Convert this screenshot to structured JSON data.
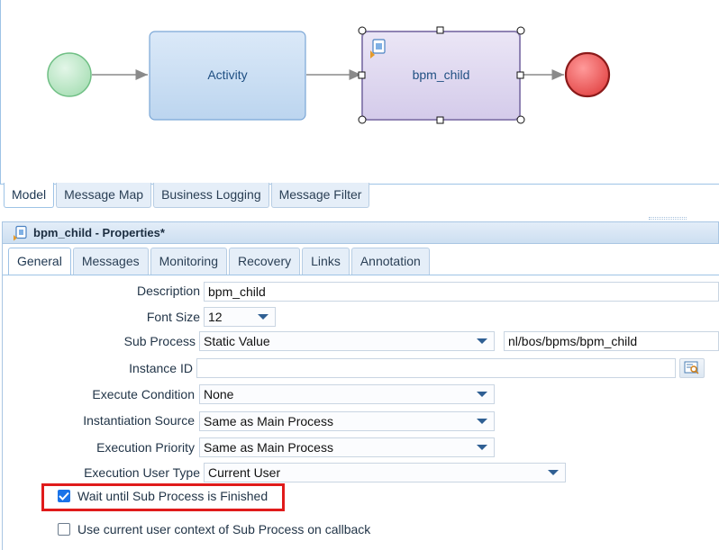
{
  "diagram": {
    "activity_label": "Activity",
    "subprocess_label": "bpm_child",
    "colors": {
      "start_event": "#b8e6c4",
      "end_event": "#ee5a5a",
      "activity_fill": "#c9def4",
      "subprocess_fill": "#ddd6ef"
    }
  },
  "view_tabs": [
    {
      "label": "Model",
      "active": true
    },
    {
      "label": "Message Map",
      "active": false
    },
    {
      "label": "Business Logging",
      "active": false
    },
    {
      "label": "Message Filter",
      "active": false
    }
  ],
  "properties": {
    "title": "bpm_child - Properties*",
    "tabs": [
      {
        "label": "General",
        "active": true
      },
      {
        "label": "Messages",
        "active": false
      },
      {
        "label": "Monitoring",
        "active": false
      },
      {
        "label": "Recovery",
        "active": false
      },
      {
        "label": "Links",
        "active": false
      },
      {
        "label": "Annotation",
        "active": false
      }
    ],
    "fields": {
      "description": {
        "label": "Description",
        "value": "bpm_child"
      },
      "font_size": {
        "label": "Font Size",
        "value": "12"
      },
      "sub_process": {
        "label": "Sub Process",
        "value": "Static Value",
        "path": "nl/bos/bpms/bpm_child"
      },
      "instance_id": {
        "label": "Instance ID",
        "value": ""
      },
      "execute_condition": {
        "label": "Execute Condition",
        "value": "None"
      },
      "instantiation_source": {
        "label": "Instantiation Source",
        "value": "Same as Main Process"
      },
      "execution_priority": {
        "label": "Execution Priority",
        "value": "Same as Main Process"
      },
      "execution_user_type": {
        "label": "Execution User Type",
        "value": "Current User"
      }
    },
    "checkboxes": {
      "wait_until_finished": {
        "label": "Wait until Sub Process is Finished",
        "checked": true
      },
      "use_user_context": {
        "label": "Use current user context of Sub Process on callback",
        "checked": false
      }
    },
    "highlight_color": "#e01b1b"
  }
}
